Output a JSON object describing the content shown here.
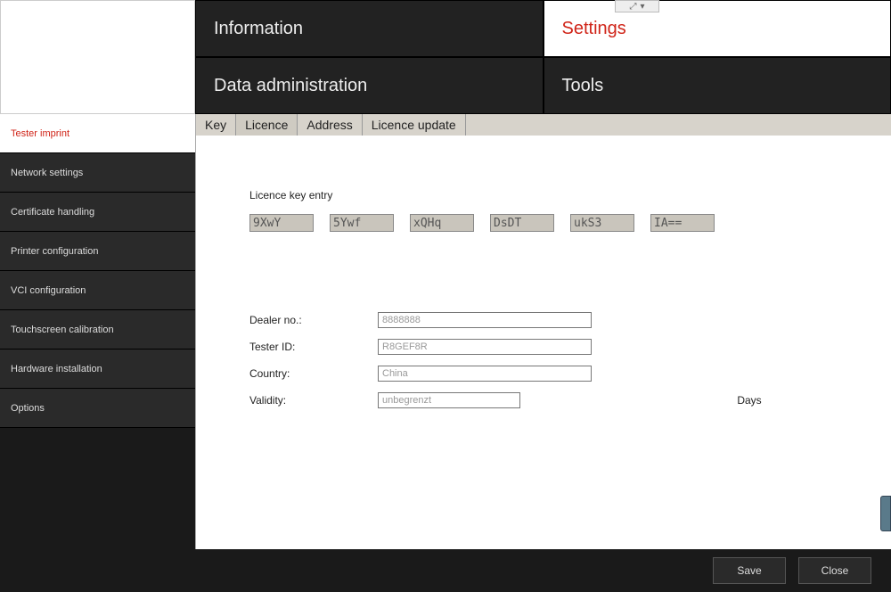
{
  "topNav": {
    "information": "Information",
    "settings": "Settings",
    "dataAdmin": "Data administration",
    "tools": "Tools"
  },
  "sidebar": {
    "items": [
      {
        "label": "Tester imprint"
      },
      {
        "label": "Network settings"
      },
      {
        "label": "Certificate handling"
      },
      {
        "label": "Printer configuration"
      },
      {
        "label": "VCI configuration"
      },
      {
        "label": "Touchscreen calibration"
      },
      {
        "label": "Hardware installation"
      },
      {
        "label": "Options"
      }
    ]
  },
  "subTabs": {
    "key": "Key",
    "licence": "Licence",
    "address": "Address",
    "licenceUpdate": "Licence update"
  },
  "content": {
    "licenceKeyEntry": "Licence key entry",
    "keys": [
      "9XwY",
      "5Ywf",
      "xQHq",
      "DsDT",
      "ukS3",
      "IA=="
    ],
    "dealerNoLabel": "Dealer no.:",
    "dealerNo": "8888888",
    "testerIdLabel": "Tester ID:",
    "testerId": "R8GEF8R",
    "countryLabel": "Country:",
    "country": "China",
    "validityLabel": "Validity:",
    "validity": "unbegrenzt",
    "daysLabel": "Days"
  },
  "footer": {
    "save": "Save",
    "close": "Close"
  }
}
